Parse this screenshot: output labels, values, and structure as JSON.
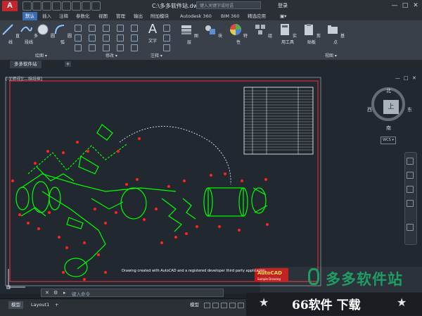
{
  "app": {
    "logo_letter": "A",
    "window_title": "C:\\多多软件站.dwg",
    "search_placeholder": "键入关键字或短语",
    "login": "登录",
    "win_minimize": "—",
    "win_maximize": "□",
    "win_close": "✕"
  },
  "ribbon_tabs": [
    "默认",
    "插入",
    "注释",
    "参数化",
    "视图",
    "管理",
    "输出",
    "附加模块",
    "Autodesk 360",
    "BIM 360",
    "精选应用",
    "▣▾"
  ],
  "ribbon_tools": [
    "直线",
    "多段线",
    "圆",
    "圆弧",
    "文字",
    "图层",
    "块",
    "特性",
    "组",
    "实用工具",
    "剪贴板",
    "基点"
  ],
  "panel_titles": [
    "绘图 ▾",
    "修改 ▾",
    "注释 ▾",
    "视图 ▾"
  ],
  "document_tab": "多多软件站",
  "new_tab": "+",
  "viewport": {
    "label": "[-][俯视][二维线框]",
    "controls": [
      "—",
      "□",
      "✕"
    ]
  },
  "viewcube": {
    "top": "上",
    "north": "北",
    "south": "南",
    "east": "东",
    "west": "西",
    "wcs": "WCS ▾"
  },
  "drawing": {
    "caption": "Drawing created with AutoCAD and a registered developer third party application",
    "stamp_title": "AutoCAD",
    "stamp_sub": "Sample Drawing"
  },
  "command_line": {
    "placeholder": "键入命令"
  },
  "status": {
    "model_tab": "模型",
    "layout_tab": "Layout1",
    "add_tab": "+",
    "model_button": "模型"
  },
  "watermark": {
    "logo": "多多软件站",
    "bottom": "66软件 下载"
  },
  "colors": {
    "accent": "#3a6db2",
    "brand_red": "#c4262e",
    "lines": "#00ff00",
    "balloons": "#ff2222",
    "sheet_border": "#ff3030"
  }
}
